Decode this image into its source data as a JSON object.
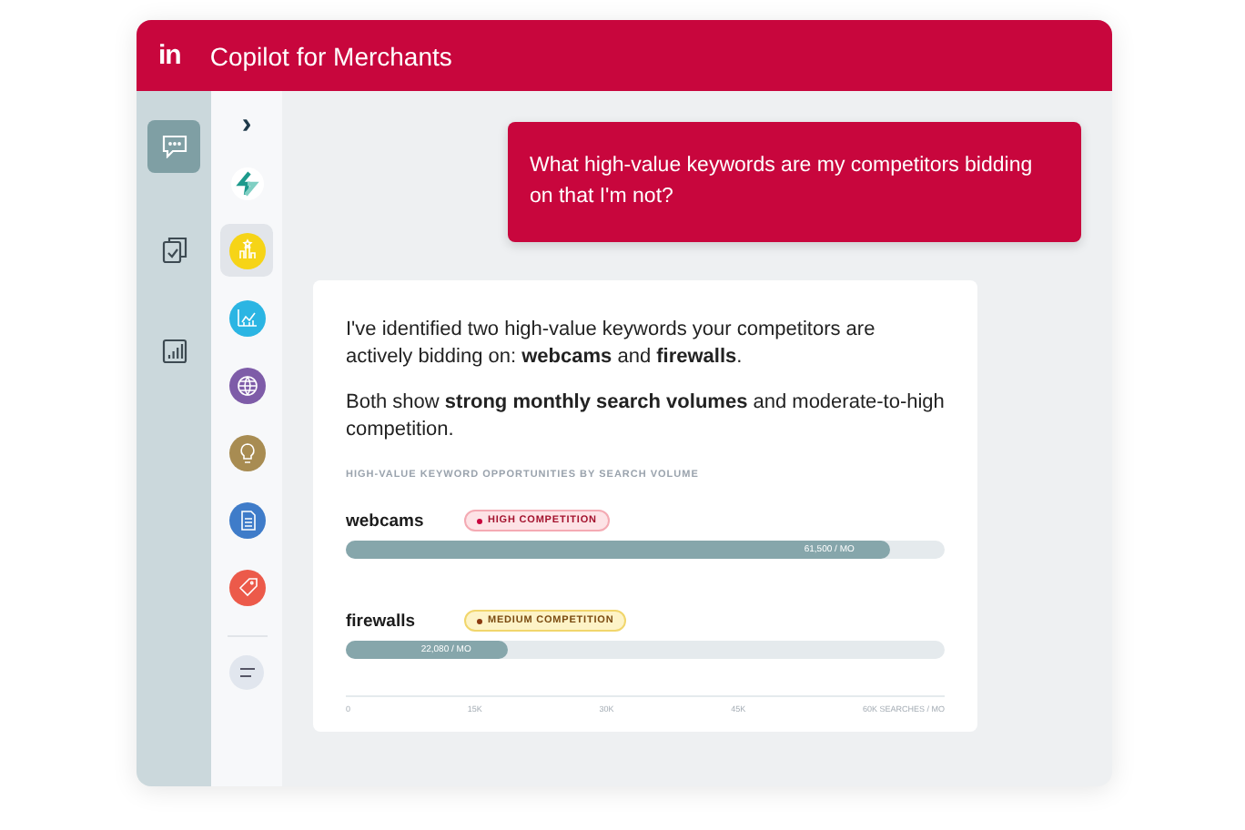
{
  "header": {
    "logo": "in",
    "title": "Copilot for Merchants"
  },
  "rail": [
    {
      "kind": "chat",
      "selected": true
    },
    {
      "kind": "clipboard",
      "selected": false
    },
    {
      "kind": "chart",
      "selected": false
    }
  ],
  "apps_toggle": "›",
  "apps": [
    {
      "kind": "logo",
      "selected": false
    },
    {
      "kind": "award",
      "color": "#f6d417",
      "selected": true
    },
    {
      "kind": "growth",
      "color": "#2bb5e3",
      "selected": false
    },
    {
      "kind": "globe",
      "color": "#7e5ca8",
      "selected": false
    },
    {
      "kind": "bulb",
      "color": "#a88c52",
      "selected": false
    },
    {
      "kind": "document",
      "color": "#3f7cc9",
      "selected": false
    },
    {
      "kind": "tag",
      "color": "#ec5a4a",
      "selected": false
    }
  ],
  "user_message": "What high-value keywords are my competitors bidding on that I'm not?",
  "reply": {
    "paragraphs": [
      "I've identified two high-value keywords your competitors are actively bidding on: **webcams** and **firewalls**.",
      "Both show **strong monthly search volumes** and moderate-to-high competition."
    ],
    "chart_title": "HIGH-VALUE KEYWORD OPPORTUNITIES BY SEARCH VOLUME",
    "rows": [
      {
        "keyword": "webcams",
        "badge": "HIGH COMPETITION",
        "kind": "high",
        "level": 0.91,
        "reading": "61,500 / MO"
      },
      {
        "keyword": "firewalls",
        "badge": "MEDIUM COMPETITION",
        "kind": "medium",
        "level": 0.27,
        "reading": "22,080 / MO"
      }
    ],
    "ticks": [
      "0",
      "15K",
      "30K",
      "45K",
      "60K SEARCHES / MO"
    ]
  }
}
